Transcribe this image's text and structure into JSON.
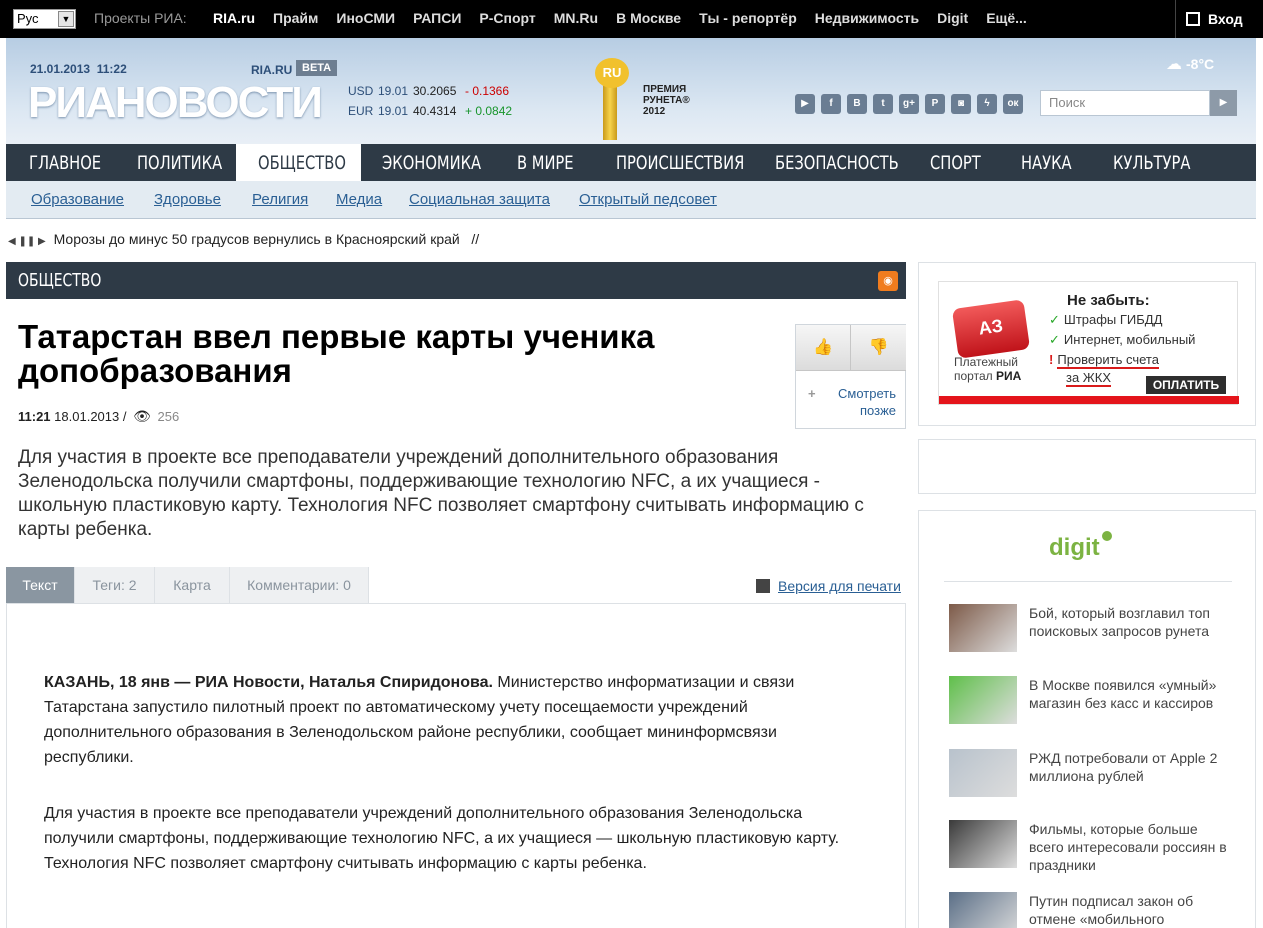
{
  "topbar": {
    "lang": "Рус",
    "projects_label": "Проекты РИА:",
    "links": [
      "RIA.ru",
      "Прайм",
      "ИноСМИ",
      "РАПСИ",
      "Р-Спорт",
      "MN.Ru",
      "В Москве",
      "Ты - репортёр",
      "Недвижимость",
      "Digit",
      "Ещё..."
    ],
    "login": "Вход"
  },
  "header": {
    "date": "21.01.2013",
    "time": "11:22",
    "brand": "РИАНОВОСТИ",
    "site": "RIA.RU",
    "beta": "BETA",
    "rates": [
      {
        "cur": "USD",
        "date": "19.01",
        "value": "30.2065",
        "change": "- 0.1366",
        "dir": "down"
      },
      {
        "cur": "EUR",
        "date": "19.01",
        "value": "40.4314",
        "change": "+ 0.0842",
        "dir": "up"
      }
    ],
    "award_ru": "RU",
    "award_lines": [
      "ПРЕМИЯ",
      "РУНЕТА®",
      "2012"
    ],
    "weather": "-8°C",
    "social_icons": [
      "youtube-icon",
      "facebook-icon",
      "vk-icon",
      "twitter-icon",
      "googleplus-icon",
      "pinterest-icon",
      "instagram-icon",
      "lightning-icon",
      "odnoklassniki-icon"
    ],
    "search_placeholder": "Поиск"
  },
  "mainnav": [
    "ГЛАВНОЕ",
    "ПОЛИТИКА",
    "ОБЩЕСТВО",
    "ЭКОНОМИКА",
    "В МИРЕ",
    "ПРОИСШЕСТВИЯ",
    "БЕЗОПАСНОСТЬ",
    "СПОРТ",
    "НАУКА",
    "КУЛЬТУРА"
  ],
  "subnav": [
    "Образование",
    "Здоровье",
    "Религия",
    "Медиа",
    "Социальная защита",
    "Открытый педсовет"
  ],
  "ticker": {
    "text": "Морозы до минус 50 градусов вернулись в Красноярский край",
    "sep": "//"
  },
  "section": {
    "title": "ОБЩЕСТВО"
  },
  "article": {
    "title": "Татарстан ввел первые карты ученика допобразования",
    "time": "11:21",
    "date": "18.01.2013 /",
    "views": "256",
    "watch_later": "Смотреть позже",
    "lead": "Для участия в проекте все преподаватели учреждений дополнительного образования Зеленодольска получили смартфоны, поддерживающие технологию NFC, а их учащиеся - школьную пластиковую карту. Технология NFC позволяет смартфону считывать информацию с карты ребенка.",
    "tabs": [
      "Текст",
      "Теги: 2",
      "Карта",
      "Комментарии: 0"
    ],
    "print": "Версия для печати",
    "p1_bold": "КАЗАНЬ, 18 янв — РИА Новости, Наталья Спиридонова.",
    "p1_rest": " Министерство информатизации и связи Татарстана запустило пилотный проект по автоматическому учету посещаемости учреждений дополнительного образования в Зеленодольском районе республики, сообщает мининформсвязи республики.",
    "p2": "Для участия в проекте все преподаватели учреждений дополнительного образования Зеленодольска получили смартфоны, поддерживающие технологию NFC, а их учащиеся — школьную пластиковую карту. Технология NFC позволяет смартфону считывать информацию с карты ребенка."
  },
  "ad": {
    "logo": "АЗ",
    "pay1": "Платежный",
    "pay2": "портал",
    "pay3": "РИА",
    "head": "Не забыть:",
    "items": [
      "Штрафы ГИБДД",
      "Интернет, мобильный",
      "Проверить счета",
      "за ЖКХ"
    ],
    "button": "ОПЛАТИТЬ"
  },
  "digit": {
    "logo": "digit",
    "news": [
      {
        "text": "Бой, который возглавил топ поисковых запросов рунета",
        "thumb": "#7d5a48"
      },
      {
        "text": "В Москве появился «умный» магазин без касс и кассиров",
        "thumb": "#5fbf4a"
      },
      {
        "text": "РЖД потребовали от Apple 2 миллиона рублей",
        "thumb": "#b8c2cc"
      },
      {
        "text": "Фильмы, которые больше всего интересовали россиян в праздники",
        "thumb": "#3a3a3a"
      },
      {
        "text": "Путин подписал закон об отмене «мобильного",
        "thumb": "#5b6f87"
      }
    ]
  }
}
